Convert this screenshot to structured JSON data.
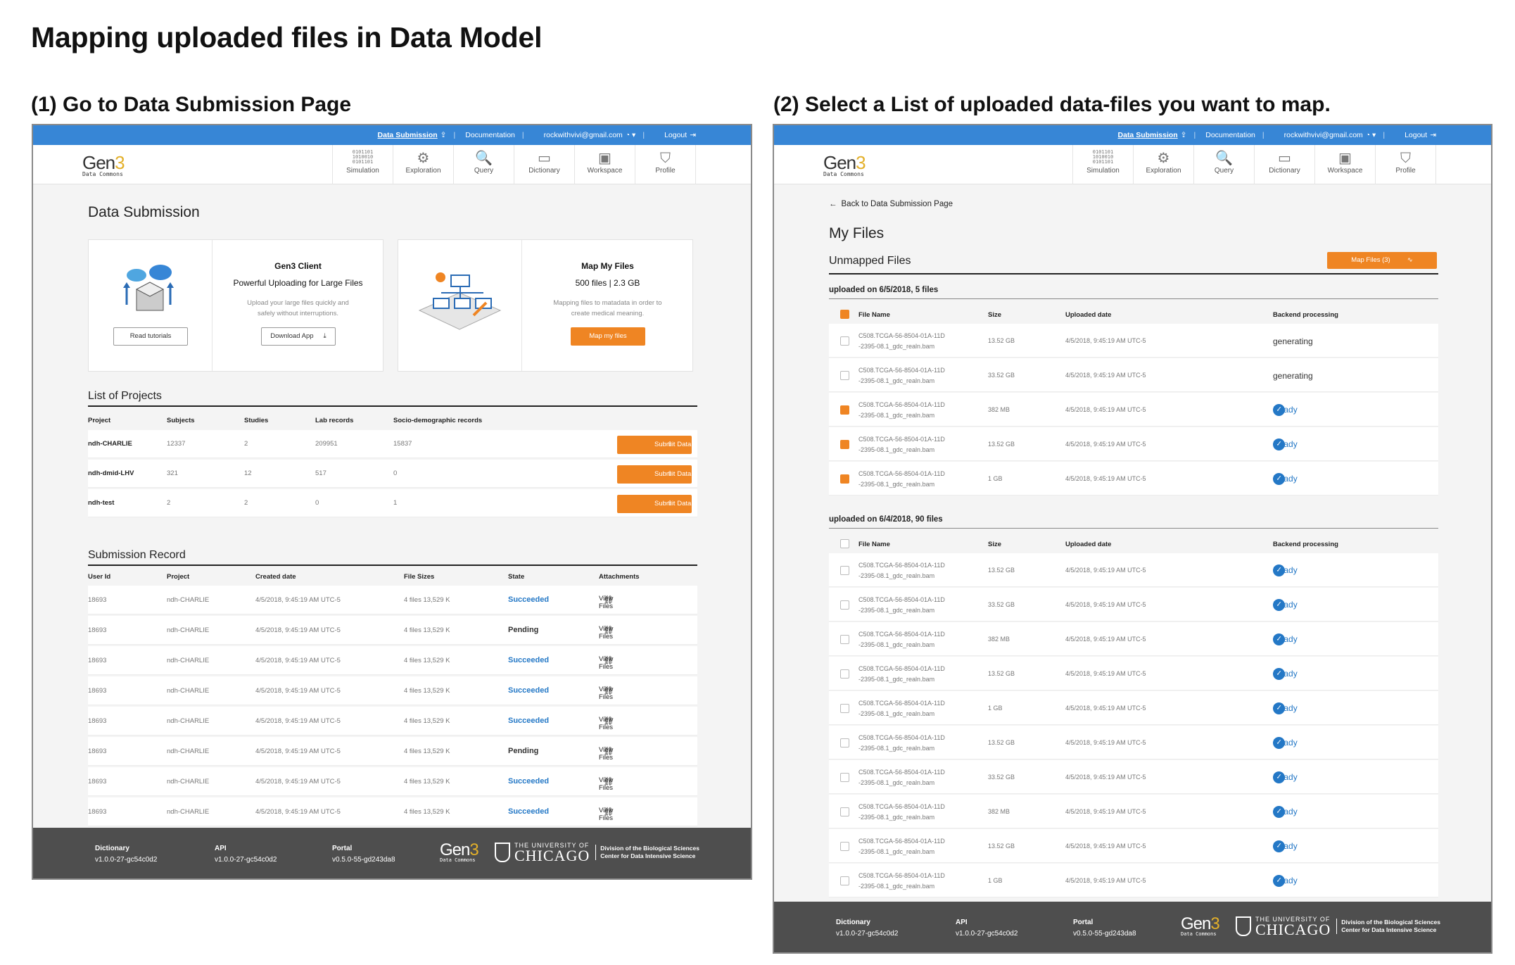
{
  "page_title": "Mapping uploaded files in Data Model",
  "step1_title": "(1) Go to Data Submission Page",
  "step2_title": "(2) Select a List of uploaded data-files you want to map.",
  "topbar": {
    "submission": "Data Submission",
    "documentation": "Documentation",
    "email": "rockwithvivi@gmail.com",
    "logout": "Logout"
  },
  "logo": {
    "gen": "Gen",
    "three": "3",
    "sub": "Data Commons"
  },
  "nav": [
    "Simulation",
    "Exploration",
    "Query",
    "Dictionary",
    "Workspace",
    "Profile"
  ],
  "nav_icons": [
    "binary-icon",
    "exploration-icon",
    "query-icon",
    "dictionary-icon",
    "workspace-icon",
    "profile-icon"
  ],
  "submission": {
    "heading": "Data Submission",
    "gen3client": {
      "title": "Gen3 Client",
      "subtitle": "Powerful Uploading for Large Files",
      "desc": "Upload your large files quickly and safely without interruptions.",
      "read_btn": "Read tutorials",
      "download_btn": "Download App"
    },
    "mapfiles": {
      "title": "Map My Files",
      "stats": "500 files | 2.3 GB",
      "desc": "Mapping files to matadata in order to create medical meaning.",
      "btn": "Map my files"
    },
    "projects_heading": "List of Projects",
    "projects_cols": [
      "Project",
      "Subjects",
      "Studies",
      "Lab records",
      "Socio-demographic records"
    ],
    "projects": [
      {
        "name": "ndh-CHARLIE",
        "subjects": "12337",
        "studies": "2",
        "lab": "209951",
        "socio": "15837"
      },
      {
        "name": "ndh-dmid-LHV",
        "subjects": "321",
        "studies": "12",
        "lab": "517",
        "socio": "0"
      },
      {
        "name": "ndh-test",
        "subjects": "2",
        "studies": "2",
        "lab": "0",
        "socio": "1"
      }
    ],
    "submit_label": "Submit Data",
    "records_heading": "Submission Record",
    "records_cols": [
      "User Id",
      "Project",
      "Created date",
      "File Sizes",
      "State",
      "Attachments"
    ],
    "records": [
      {
        "id": "18693",
        "project": "ndh-CHARLIE",
        "date": "4/5/2018, 9:45:19 AM UTC-5",
        "files": "4 files  13,529 K",
        "state": "Succeeded"
      },
      {
        "id": "18693",
        "project": "ndh-CHARLIE",
        "date": "4/5/2018, 9:45:19 AM UTC-5",
        "files": "4 files  13,529 K",
        "state": "Pending"
      },
      {
        "id": "18693",
        "project": "ndh-CHARLIE",
        "date": "4/5/2018, 9:45:19 AM UTC-5",
        "files": "4 files  13,529 K",
        "state": "Succeeded"
      },
      {
        "id": "18693",
        "project": "ndh-CHARLIE",
        "date": "4/5/2018, 9:45:19 AM UTC-5",
        "files": "4 files  13,529 K",
        "state": "Succeeded"
      },
      {
        "id": "18693",
        "project": "ndh-CHARLIE",
        "date": "4/5/2018, 9:45:19 AM UTC-5",
        "files": "4 files  13,529 K",
        "state": "Succeeded"
      },
      {
        "id": "18693",
        "project": "ndh-CHARLIE",
        "date": "4/5/2018, 9:45:19 AM UTC-5",
        "files": "4 files  13,529 K",
        "state": "Pending"
      },
      {
        "id": "18693",
        "project": "ndh-CHARLIE",
        "date": "4/5/2018, 9:45:19 AM UTC-5",
        "files": "4 files  13,529 K",
        "state": "Succeeded"
      },
      {
        "id": "18693",
        "project": "ndh-CHARLIE",
        "date": "4/5/2018, 9:45:19 AM UTC-5",
        "files": "4 files  13,529 K",
        "state": "Succeeded"
      }
    ],
    "view_files": "View Files"
  },
  "myfiles": {
    "back": "Back to Data Submission Page",
    "heading": "My Files",
    "unmapped": "Unmapped Files",
    "map_btn": "Map Files (3)",
    "cols": [
      "File Name",
      "Size",
      "Uploaded date",
      "Backend processing"
    ],
    "group1": {
      "label": "uploaded on 6/5/2018, 5 files",
      "rows": [
        {
          "name1": "C508.TCGA-56-8504-01A-11D",
          "name2": "-2395-08.1_gdc_realn.bam",
          "size": "13.52 GB",
          "date": "4/5/2018, 9:45:19 AM UTC-5",
          "status": "generating",
          "checked": false
        },
        {
          "name1": "C508.TCGA-56-8504-01A-11D",
          "name2": "-2395-08.1_gdc_realn.bam",
          "size": "33.52 GB",
          "date": "4/5/2018, 9:45:19 AM UTC-5",
          "status": "generating",
          "checked": false
        },
        {
          "name1": "C508.TCGA-56-8504-01A-11D",
          "name2": "-2395-08.1_gdc_realn.bam",
          "size": "382 MB",
          "date": "4/5/2018, 9:45:19 AM UTC-5",
          "status": "Ready",
          "checked": true
        },
        {
          "name1": "C508.TCGA-56-8504-01A-11D",
          "name2": "-2395-08.1_gdc_realn.bam",
          "size": "13.52 GB",
          "date": "4/5/2018, 9:45:19 AM UTC-5",
          "status": "Ready",
          "checked": true
        },
        {
          "name1": "C508.TCGA-56-8504-01A-11D",
          "name2": "-2395-08.1_gdc_realn.bam",
          "size": "1 GB",
          "date": "4/5/2018, 9:45:19 AM UTC-5",
          "status": "Ready",
          "checked": true
        }
      ]
    },
    "group2": {
      "label": "uploaded on 6/4/2018, 90 files",
      "rows": [
        {
          "name1": "C508.TCGA-56-8504-01A-11D",
          "name2": "-2395-08.1_gdc_realn.bam",
          "size": "13.52 GB",
          "date": "4/5/2018, 9:45:19 AM UTC-5",
          "status": "Ready"
        },
        {
          "name1": "C508.TCGA-56-8504-01A-11D",
          "name2": "-2395-08.1_gdc_realn.bam",
          "size": "33.52 GB",
          "date": "4/5/2018, 9:45:19 AM UTC-5",
          "status": "Ready"
        },
        {
          "name1": "C508.TCGA-56-8504-01A-11D",
          "name2": "-2395-08.1_gdc_realn.bam",
          "size": "382 MB",
          "date": "4/5/2018, 9:45:19 AM UTC-5",
          "status": "Ready"
        },
        {
          "name1": "C508.TCGA-56-8504-01A-11D",
          "name2": "-2395-08.1_gdc_realn.bam",
          "size": "13.52 GB",
          "date": "4/5/2018, 9:45:19 AM UTC-5",
          "status": "Ready"
        },
        {
          "name1": "C508.TCGA-56-8504-01A-11D",
          "name2": "-2395-08.1_gdc_realn.bam",
          "size": "1 GB",
          "date": "4/5/2018, 9:45:19 AM UTC-5",
          "status": "Ready"
        },
        {
          "name1": "C508.TCGA-56-8504-01A-11D",
          "name2": "-2395-08.1_gdc_realn.bam",
          "size": "13.52 GB",
          "date": "4/5/2018, 9:45:19 AM UTC-5",
          "status": "Ready"
        },
        {
          "name1": "C508.TCGA-56-8504-01A-11D",
          "name2": "-2395-08.1_gdc_realn.bam",
          "size": "33.52 GB",
          "date": "4/5/2018, 9:45:19 AM UTC-5",
          "status": "Ready"
        },
        {
          "name1": "C508.TCGA-56-8504-01A-11D",
          "name2": "-2395-08.1_gdc_realn.bam",
          "size": "382 MB",
          "date": "4/5/2018, 9:45:19 AM UTC-5",
          "status": "Ready"
        },
        {
          "name1": "C508.TCGA-56-8504-01A-11D",
          "name2": "-2395-08.1_gdc_realn.bam",
          "size": "13.52 GB",
          "date": "4/5/2018, 9:45:19 AM UTC-5",
          "status": "Ready"
        },
        {
          "name1": "C508.TCGA-56-8504-01A-11D",
          "name2": "-2395-08.1_gdc_realn.bam",
          "size": "1 GB",
          "date": "4/5/2018, 9:45:19 AM UTC-5",
          "status": "Ready"
        }
      ]
    }
  },
  "footer": {
    "dictionary_label": "Dictionary",
    "dictionary_ver": "v1.0.0-27-gc54c0d2",
    "api_label": "API",
    "api_ver": "v1.0.0-27-gc54c0d2",
    "portal_label": "Portal",
    "portal_ver": "v0.5.0-55-gd243da8",
    "uc_top": "THE UNIVERSITY OF",
    "uc_main": "CHICAGO",
    "division": "Division of the Biological Sciences",
    "center": "Center for Data Intensive Science"
  },
  "colors": {
    "accent": "#ef8523",
    "topbar": "#3786d6",
    "footer": "#4e4e4e",
    "link": "#2478c6"
  }
}
